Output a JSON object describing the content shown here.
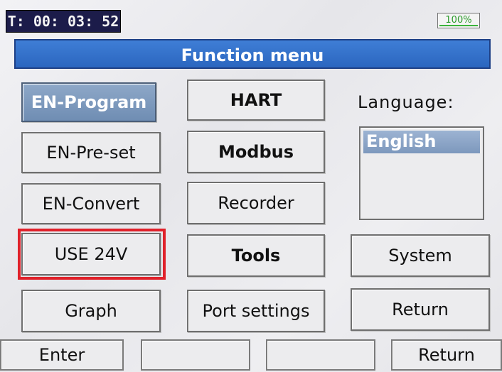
{
  "status": {
    "timer": "T: 00: 03: 52",
    "battery": "100%"
  },
  "title": "Function menu",
  "menu": {
    "col1": [
      "EN-Program",
      "EN-Pre-set",
      "EN-Convert",
      "USE 24V",
      "Graph"
    ],
    "col2": [
      "HART",
      "Modbus",
      "Recorder",
      "Tools",
      "Port settings"
    ],
    "col3_buttons": [
      "System",
      "Return"
    ],
    "selected": "EN-Program",
    "highlighted": "USE 24V"
  },
  "language": {
    "label": "Language:",
    "options": [
      "English"
    ],
    "selected": "English"
  },
  "softkeys": [
    "Enter",
    "",
    "",
    "Return"
  ],
  "colors": {
    "title_bar": "#2b66bf",
    "selected_button": "#7d98bd",
    "highlight_box": "#e0212a",
    "timer_bg": "#1c1c4a"
  }
}
